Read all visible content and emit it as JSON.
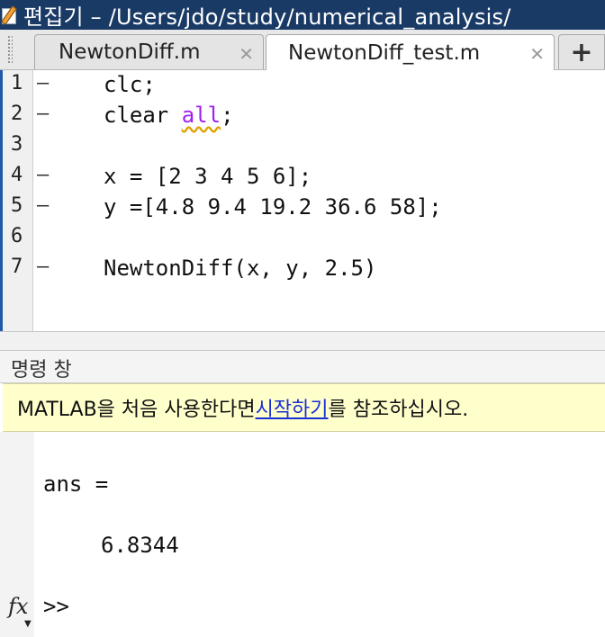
{
  "window": {
    "title": "편집기 – /Users/jdo/study/numerical_analysis/"
  },
  "tabs": [
    {
      "label": "NewtonDiff.m",
      "active": false
    },
    {
      "label": "NewtonDiff_test.m",
      "active": true
    }
  ],
  "add_tab_label": "+",
  "close_glyph": "✕",
  "editor": {
    "lines": [
      {
        "num": "1",
        "marker": "–",
        "code": "clc;"
      },
      {
        "num": "2",
        "marker": "–",
        "code_a": "clear ",
        "code_b": "all",
        "code_c": ";"
      },
      {
        "num": "3",
        "marker": "",
        "code": ""
      },
      {
        "num": "4",
        "marker": "–",
        "code": "x = [2 3 4 5 6];"
      },
      {
        "num": "5",
        "marker": "–",
        "code": "y =[4.8 9.4 19.2 36.6 58];"
      },
      {
        "num": "6",
        "marker": "",
        "code": ""
      },
      {
        "num": "7",
        "marker": "–",
        "code": "NewtonDiff(x, y, 2.5)"
      }
    ]
  },
  "command_window": {
    "title": "명령 창",
    "notice_prefix": "MATLAB을 처음 사용한다면 ",
    "notice_link": "시작하기",
    "notice_suffix": "를 참조하십시오.",
    "ans_label": "ans =",
    "ans_value": "6.8344",
    "prompt": ">>",
    "fx_label": "fx"
  }
}
